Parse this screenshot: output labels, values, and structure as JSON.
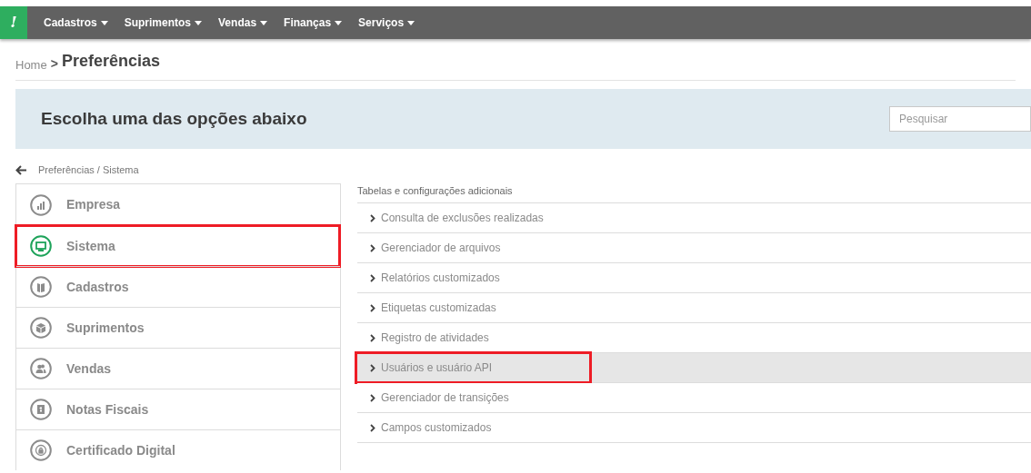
{
  "navbar": {
    "logo": "!",
    "menus": [
      {
        "label": "Cadastros"
      },
      {
        "label": "Suprimentos"
      },
      {
        "label": "Vendas"
      },
      {
        "label": "Finanças"
      },
      {
        "label": "Serviços"
      }
    ]
  },
  "breadcrumb": {
    "home": "Home",
    "separator": ">",
    "current": "Preferências"
  },
  "banner": {
    "title": "Escolha uma das opções abaixo",
    "search": {
      "placeholder": "Pesquisar"
    }
  },
  "back_link": "Preferências / Sistema",
  "categories": [
    {
      "label": "Empresa",
      "selected": false,
      "highlighted": false
    },
    {
      "label": "Sistema",
      "selected": true,
      "highlighted": true
    },
    {
      "label": "Cadastros",
      "selected": false,
      "highlighted": false
    },
    {
      "label": "Suprimentos",
      "selected": false,
      "highlighted": false
    },
    {
      "label": "Vendas",
      "selected": false,
      "highlighted": false
    },
    {
      "label": "Notas Fiscais",
      "selected": false,
      "highlighted": false
    },
    {
      "label": "Certificado Digital",
      "selected": false,
      "highlighted": false
    }
  ],
  "options": {
    "heading": "Tabelas e configurações adicionais",
    "items": [
      {
        "label": "Consulta de exclusões realizadas",
        "selected": false,
        "highlighted": false
      },
      {
        "label": "Gerenciador de arquivos",
        "selected": false,
        "highlighted": false
      },
      {
        "label": "Relatórios customizados",
        "selected": false,
        "highlighted": false
      },
      {
        "label": "Etiquetas customizadas",
        "selected": false,
        "highlighted": false
      },
      {
        "label": "Registro de atividades",
        "selected": false,
        "highlighted": false
      },
      {
        "label": "Usuários e usuário API",
        "selected": true,
        "highlighted": true
      },
      {
        "label": "Gerenciador de transições",
        "selected": false,
        "highlighted": false
      },
      {
        "label": "Campos customizados",
        "selected": false,
        "highlighted": false
      }
    ]
  }
}
